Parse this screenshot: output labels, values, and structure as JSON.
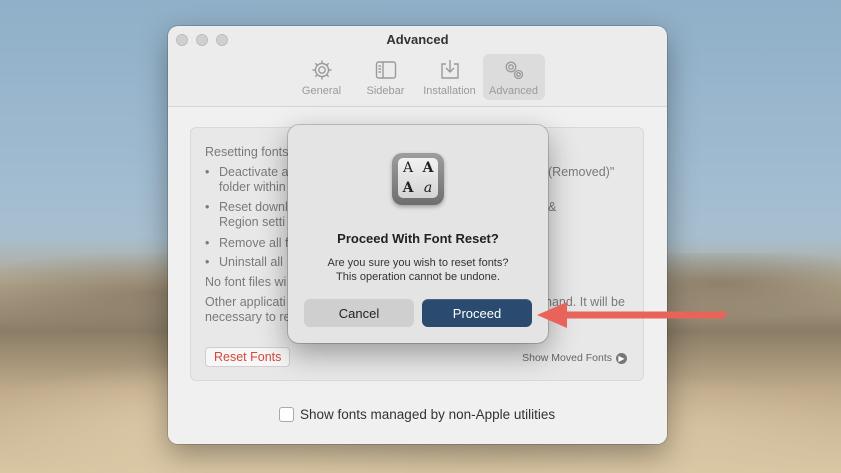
{
  "window": {
    "title": "Advanced",
    "toolbar": [
      {
        "label": "General",
        "icon": "gear-icon"
      },
      {
        "label": "Sidebar",
        "icon": "sidebar-icon"
      },
      {
        "label": "Installation",
        "icon": "download-tray-icon"
      },
      {
        "label": "Advanced",
        "icon": "gears-icon",
        "active": true
      }
    ]
  },
  "group": {
    "intro": "Resetting fonts",
    "bullets": [
      {
        "line1": "Deactivate a",
        "line1_tail": "(Removed)\"",
        "line2": "folder within"
      },
      {
        "line1": "Reset downl",
        "line1_tail": "&",
        "line2": "Region setti"
      },
      {
        "line1": "Remove all f"
      },
      {
        "line1": "Uninstall all"
      }
    ],
    "note1": "No font files wi",
    "note2_line1": "Other applicati",
    "note2_tail": "nand. It will be",
    "note2_line2": "necessary to re",
    "reset_button": "Reset Fonts",
    "moved_link": "Show Moved Fonts"
  },
  "checkbox_label": "Show fonts managed by non-Apple utilities",
  "dialog": {
    "title": "Proceed With Font Reset?",
    "message_line1": "Are you sure you wish to reset fonts?",
    "message_line2": "This operation cannot be undone.",
    "cancel": "Cancel",
    "proceed": "Proceed"
  },
  "colors": {
    "accent_button": "#2a4a6f",
    "reset_text": "#d6473a",
    "annotation_arrow": "#e8645a"
  }
}
